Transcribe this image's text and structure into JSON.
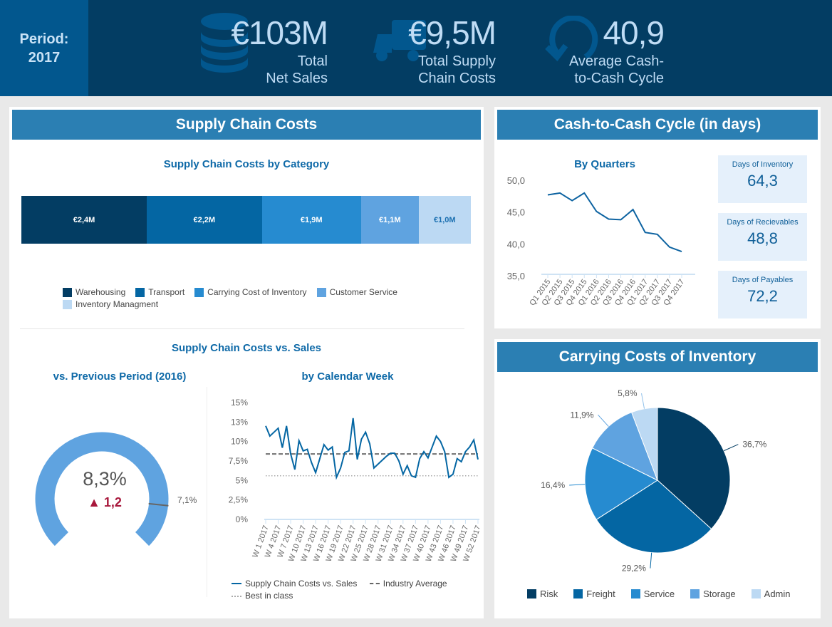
{
  "header": {
    "period_label": "Period:",
    "period_value": "2017",
    "kpis": [
      {
        "value": "€103M",
        "label_line1": "Total",
        "label_line2": "Net Sales",
        "icon": "coins-stack-icon"
      },
      {
        "value": "€9,5M",
        "label_line1": "Total Supply",
        "label_line2": "Chain Costs",
        "icon": "truck-icon"
      },
      {
        "value": "40,9",
        "label_line1": "Average Cash-",
        "label_line2": "to-Cash Cycle",
        "icon": "cycle-arrow-icon"
      }
    ]
  },
  "supply_chain_costs": {
    "title": "Supply Chain Costs",
    "by_category_title": "Supply Chain Costs by Category",
    "vs_sales_title": "Supply Chain Costs vs. Sales",
    "gauge_title": "vs. Previous Period (2016)",
    "gauge_value": "8,3%",
    "gauge_delta": "1,2",
    "gauge_previous_label": "7,1%",
    "weekly_title": "by Calendar Week"
  },
  "cash_cycle": {
    "title": "Cash-to-Cash Cycle (in days)",
    "quarters_title": "By Quarters",
    "boxes": [
      {
        "label": "Days of Inventory",
        "value": "64,3"
      },
      {
        "label": "Days of Recievables",
        "value": "48,8"
      },
      {
        "label": "Days of Payables",
        "value": "72,2"
      }
    ]
  },
  "carrying_costs": {
    "title": "Carrying Costs of Inventory"
  },
  "colors": {
    "dark": "#033d63",
    "mid": "#0466a3",
    "blue": "#268bd0",
    "light": "#5fa3e0",
    "pale": "#bcd9f3",
    "accent_red": "#a8183c"
  },
  "chart_data": [
    {
      "type": "bar",
      "title": "Supply Chain Costs by Category",
      "stacked": true,
      "orientation": "horizontal",
      "categories": [
        "Warehousing",
        "Transport",
        "Carrying Cost of Inventory",
        "Customer Service",
        "Inventory Managment"
      ],
      "values": [
        2.4,
        2.2,
        1.9,
        1.1,
        1.0
      ],
      "labels": [
        "€2,4M",
        "€2,2M",
        "€1,9M",
        "€1,1M",
        "€1,0M"
      ],
      "colors": [
        "#033d63",
        "#0466a3",
        "#268bd0",
        "#5fa3e0",
        "#bcd9f3"
      ],
      "legend": "bottom"
    },
    {
      "type": "gauge",
      "title": "vs. Previous Period (2016)",
      "value": 8.3,
      "previous": 7.1,
      "delta": 1.2,
      "unit": "%"
    },
    {
      "type": "line",
      "title": "by Calendar Week",
      "x_tick_labels": [
        "W 1 2017",
        "W 4 2017",
        "W 7 2017",
        "W 10 2017",
        "W 13 2017",
        "W 16 2017",
        "W 19 2017",
        "W 22 2017",
        "W 25 2017",
        "W 28 2017",
        "W 31 2017",
        "W 34 2017",
        "W 37 2017",
        "W 40 2017",
        "W 43 2017",
        "W 46 2017",
        "W 49 2017",
        "W 52 2017"
      ],
      "y_tick_labels": [
        "0%",
        "2,5%",
        "5%",
        "7,5%",
        "10%",
        "13%",
        "15%"
      ],
      "ylim": [
        0,
        15
      ],
      "series": [
        {
          "name": "Supply Chain Costs vs. Sales",
          "style": "solid",
          "values": [
            12.0,
            10.7,
            11.2,
            11.7,
            9.2,
            12.0,
            8.4,
            6.4,
            10.1,
            8.8,
            9.0,
            7.3,
            6.0,
            7.8,
            9.6,
            8.9,
            9.3,
            5.4,
            6.6,
            8.6,
            8.8,
            13.0,
            7.7,
            10.3,
            11.2,
            9.7,
            6.6,
            7.1,
            7.6,
            8.1,
            8.5,
            8.5,
            7.5,
            5.8,
            6.9,
            5.6,
            5.4,
            7.8,
            8.7,
            7.9,
            9.3,
            10.7,
            10.0,
            8.7,
            5.4,
            5.8,
            7.8,
            7.4,
            8.7,
            9.3,
            10.2,
            7.7
          ]
        },
        {
          "name": "Industry Average",
          "style": "dashed",
          "values_constant": 8.4
        },
        {
          "name": "Best in class",
          "style": "dotted",
          "values_constant": 5.6
        }
      ],
      "legend": "bottom"
    },
    {
      "type": "line",
      "title": "By Quarters",
      "categories": [
        "Q1 2015",
        "Q2 2015",
        "Q3 2015",
        "Q4 2015",
        "Q1 2016",
        "Q2 2016",
        "Q3 2016",
        "Q4 2016",
        "Q1 2017",
        "Q2 2017",
        "Q3 2017",
        "Q4 2017"
      ],
      "values": [
        47.7,
        48.0,
        46.8,
        48.0,
        45.1,
        43.9,
        43.8,
        45.4,
        41.8,
        41.5,
        39.5,
        38.8
      ],
      "y_tick_labels": [
        "35,0",
        "40,0",
        "45,0",
        "50,0"
      ],
      "ylim": [
        35,
        50
      ]
    },
    {
      "type": "pie",
      "title": "Carrying Costs of Inventory",
      "categories": [
        "Risk",
        "Freight",
        "Service",
        "Storage",
        "Admin"
      ],
      "values": [
        36.7,
        29.2,
        16.4,
        11.9,
        5.8
      ],
      "labels": [
        "36,7%",
        "29,2%",
        "16,4%",
        "11,9%",
        "5,8%"
      ],
      "colors": [
        "#033d63",
        "#0466a3",
        "#268bd0",
        "#5fa3e0",
        "#bcd9f3"
      ],
      "legend": "bottom"
    }
  ]
}
